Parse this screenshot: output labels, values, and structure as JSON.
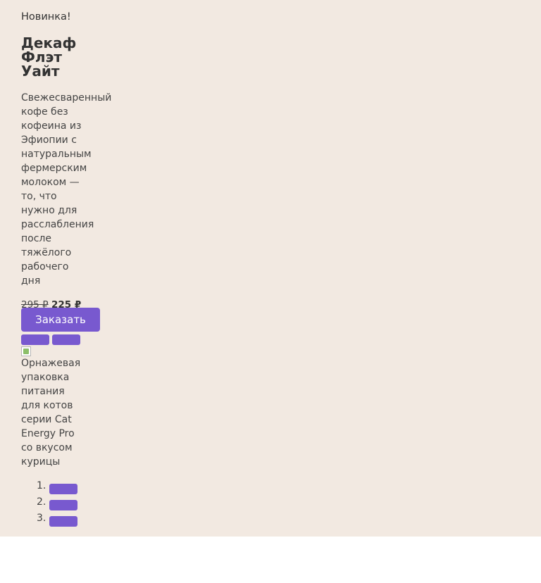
{
  "promo": {
    "tag": "Новинка!",
    "title_lines": [
      "Декаф",
      "Флэт",
      "Уайт"
    ],
    "description_lines": [
      "Свежесваренный",
      "кофе без",
      "кофеина из",
      "Эфиопии с",
      "натуральным",
      "фермерским",
      "молоком —",
      "то, что",
      "нужно для",
      "расслабления",
      "после",
      "тяжёлого",
      "рабочего",
      "дня"
    ],
    "price_old": "295 ₽",
    "price_new": "225 ₽",
    "order_label": "Заказать",
    "image_alt_lines": [
      "Орнажевая",
      "упаковка",
      "питания",
      "для котов",
      "серии Cat",
      "Energy Pro",
      "со вкусом",
      "курицы"
    ],
    "dots": [
      "1.",
      "2.",
      "3."
    ]
  },
  "colors": {
    "background": "#f2e9e1",
    "accent": "#7859cf",
    "text": "#333333"
  },
  "icons": {
    "broken_image": "broken-image-icon"
  }
}
